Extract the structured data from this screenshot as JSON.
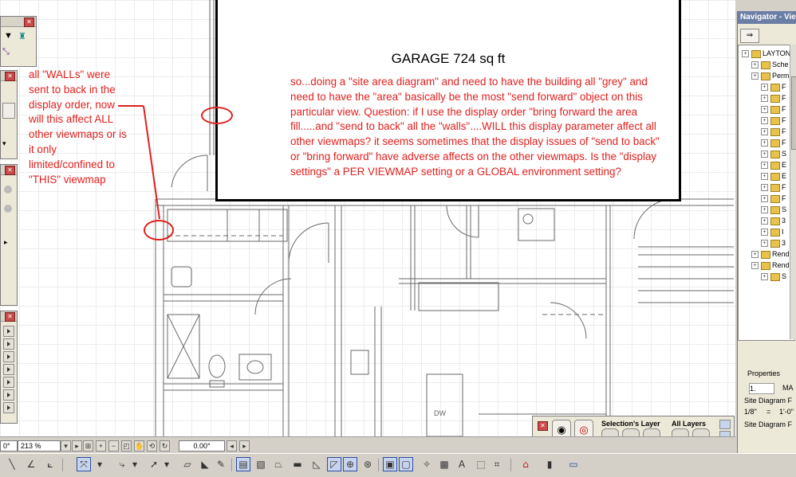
{
  "canvas": {
    "garage_label": "GARAGE 724 sq ft",
    "note_main": "so...doing a \"site area diagram\" and need to have the building all \"grey\" and need to have the \"area\" basically be the most \"send forward\" object on this particular view. Question: if I use the display order \"bring forward the area fill.....and \"send to back\" all the \"walls\"....WILL this display parameter affect all other viewmaps? it seems sometimes that the display issues of \"send to back\" or \"bring forward\" have adverse affects on the other viewmaps. Is the \"display settings\" a PER VIEWMAP setting or a GLOBAL environment setting?",
    "note_left": "all \"WALLs\" were sent to back in the display order, now will this affect ALL other viewmaps or is it only limited/confined to \"THIS\" viewmap",
    "appliance_label": "DW",
    "annotation_color": "#e0201e"
  },
  "statusbar": {
    "field_left": "0°",
    "zoom": "213 %",
    "angle": "0.00°"
  },
  "navigator": {
    "title": "Navigator - Vie",
    "tree": [
      {
        "label": "LAYTON",
        "level": 0,
        "icon": "project-icon"
      },
      {
        "label": "Sche",
        "level": 1,
        "icon": "folder-icon"
      },
      {
        "label": "Perm",
        "level": 1,
        "icon": "folder-icon"
      },
      {
        "label": "F",
        "level": 2,
        "icon": "folder-icon"
      },
      {
        "label": "F",
        "level": 2,
        "icon": "folder-icon"
      },
      {
        "label": "F",
        "level": 2,
        "icon": "folder-icon"
      },
      {
        "label": "F",
        "level": 2,
        "icon": "folder-icon"
      },
      {
        "label": "F",
        "level": 2,
        "icon": "folder-icon"
      },
      {
        "label": "F",
        "level": 2,
        "icon": "folder-icon"
      },
      {
        "label": "S",
        "level": 2,
        "icon": "folder-icon"
      },
      {
        "label": "E",
        "level": 2,
        "icon": "folder-icon"
      },
      {
        "label": "E",
        "level": 2,
        "icon": "folder-icon"
      },
      {
        "label": "F",
        "level": 2,
        "icon": "folder-icon"
      },
      {
        "label": "F",
        "level": 2,
        "icon": "folder-icon"
      },
      {
        "label": "S",
        "level": 2,
        "icon": "folder-icon"
      },
      {
        "label": "3",
        "level": 2,
        "icon": "view-icon"
      },
      {
        "label": "I",
        "level": 2,
        "icon": "view-icon"
      },
      {
        "label": "3",
        "level": 2,
        "icon": "view-icon"
      },
      {
        "label": "Rend",
        "level": 1,
        "icon": "folder-icon"
      },
      {
        "label": "Rend",
        "level": 1,
        "icon": "folder-icon"
      },
      {
        "label": "S",
        "level": 2,
        "icon": "folder-icon"
      }
    ],
    "properties_title": "Properties",
    "prop_id": "1.",
    "prop_name": "MA",
    "prop_site1": "Site Diagram F",
    "prop_scale": "1/8\"",
    "prop_eq": "=",
    "prop_scale2": "1'-0\"",
    "prop_site2": "Site Diagram F"
  },
  "layer_palette": {
    "selections_label": "Selection's Layer",
    "all_layers_label": "All Layers"
  }
}
